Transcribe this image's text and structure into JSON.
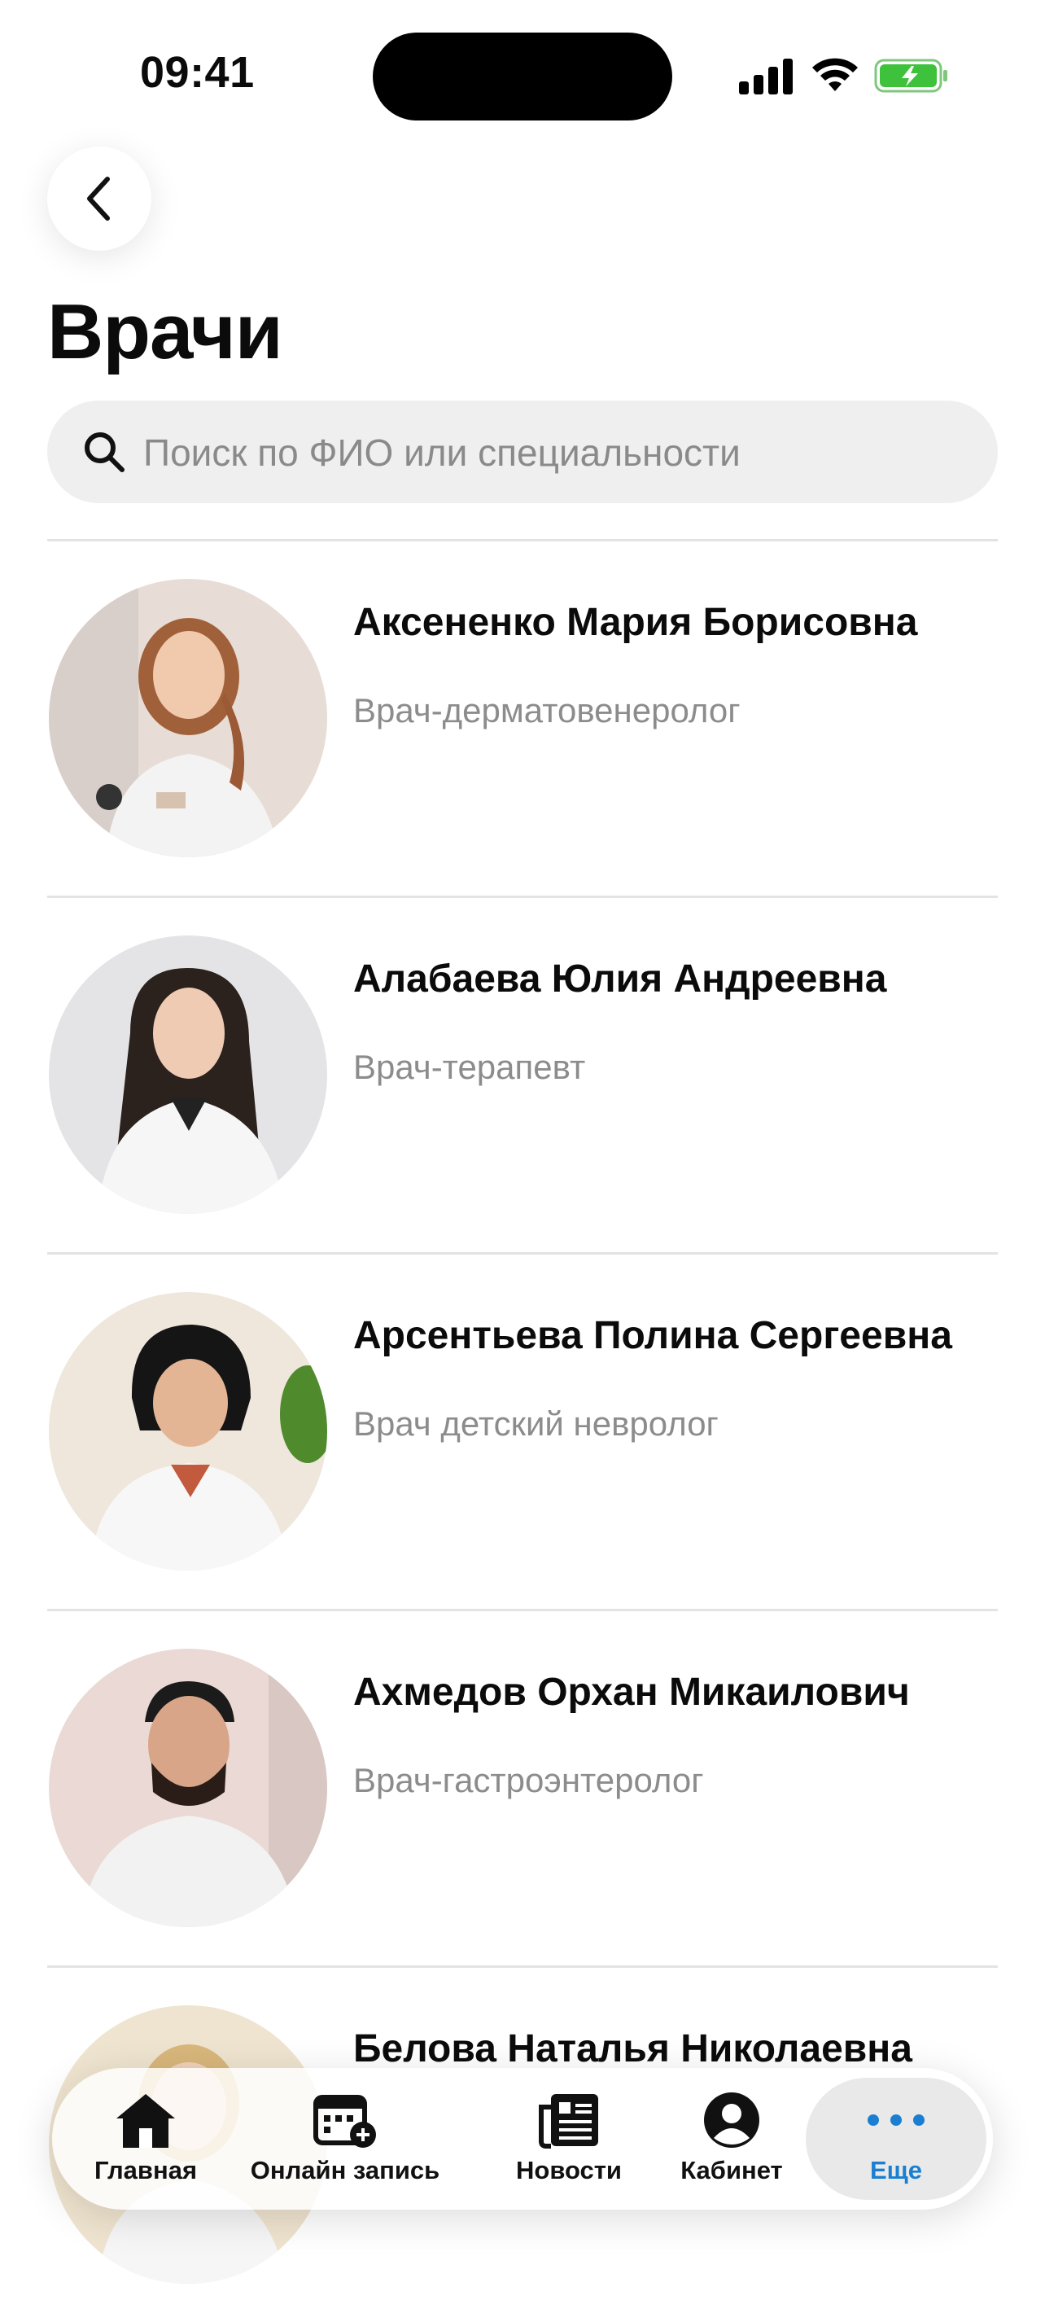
{
  "status_bar": {
    "time": "09:41"
  },
  "header": {
    "title": "Врачи"
  },
  "search": {
    "placeholder": "Поиск по ФИО или специальности",
    "value": ""
  },
  "doctors": [
    {
      "name": "Аксененко Мария Борисовна",
      "specialty": "Врач-дерматовенеролог"
    },
    {
      "name": "Алабаева Юлия Андреевна",
      "specialty": "Врач-терапевт"
    },
    {
      "name": "Арсентьева Полина Сергеевна",
      "specialty": "Врач детский невролог"
    },
    {
      "name": "Ахмедов Орхан Микаилович",
      "specialty": "Врач-гастроэнтеролог"
    },
    {
      "name": "Белова Наталья Николаевна",
      "specialty": ""
    }
  ],
  "tab_bar": {
    "items": [
      {
        "label": "Главная",
        "icon": "home-icon"
      },
      {
        "label": "Онлайн запись",
        "icon": "calendar-add-icon"
      },
      {
        "label": "Новости",
        "icon": "newspaper-icon"
      },
      {
        "label": "Кабинет",
        "icon": "profile-icon"
      },
      {
        "label": "Еще",
        "icon": "more-dots-icon"
      }
    ],
    "active_index": 4,
    "active_color": "#1a7fd0"
  }
}
